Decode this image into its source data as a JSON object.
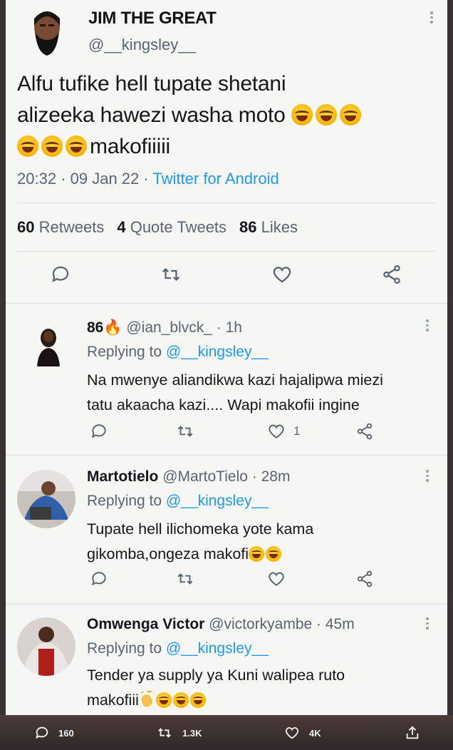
{
  "main_tweet": {
    "display_name": "JIM THE GREAT",
    "handle": "@__kingsley__",
    "text_line1": "Alfu tufike hell tupate shetani",
    "text_line2": "alizeeka hawezi washa moto",
    "text_line3": "makofiiiii",
    "time": "20:32",
    "date": "09 Jan 22",
    "source": "Twitter for Android",
    "retweets_count": "60",
    "retweets_label": "Retweets",
    "quotes_count": "4",
    "quotes_label": "Quote Tweets",
    "likes_count": "86",
    "likes_label": "Likes"
  },
  "replies": [
    {
      "name": "86",
      "handle": "@ian_blvck_",
      "time": "1h",
      "replying_label": "Replying to",
      "mention": "@__kingsley__",
      "text_line1": "Na mwenye aliandikwa kazi hajalipwa miezi",
      "text_line2": "tatu akaacha kazi.... Wapi makofii ingine",
      "like_count": "1"
    },
    {
      "name": "Martotielo",
      "handle": "@MartoTielo",
      "time": "28m",
      "replying_label": "Replying to",
      "mention": "@__kingsley__",
      "text_line1": "Tupate hell ilichomeka yote kama",
      "text_line2": "gikomba,ongeza makofi"
    },
    {
      "name": "Omwenga Victor",
      "handle": "@victorkyambe",
      "time": "45m",
      "replying_label": "Replying to",
      "mention": "@__kingsley__",
      "text_line1": "Tender ya supply ya Kuni walipea ruto",
      "text_line2": "makofiii"
    }
  ],
  "bottom_bar": {
    "comments": "160",
    "retweets": "1.3K",
    "likes": "4K"
  },
  "colors": {
    "link_blue": "#1d9bf0",
    "text_gray": "#5b6570",
    "text_dark": "#14171a"
  }
}
